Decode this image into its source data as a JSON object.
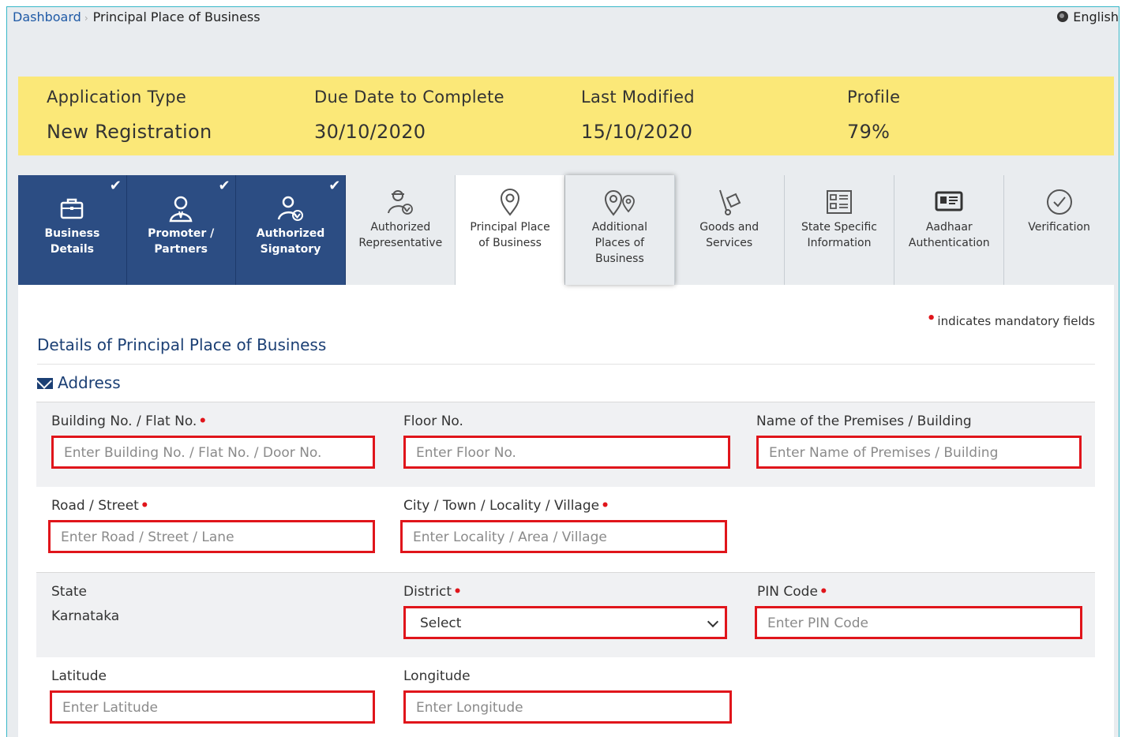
{
  "breadcrumb": {
    "home": "Dashboard",
    "current": "Principal Place of Business"
  },
  "language": "English",
  "info": [
    {
      "label": "Application Type",
      "value": "New Registration"
    },
    {
      "label": "Due Date to Complete",
      "value": "30/10/2020"
    },
    {
      "label": "Last Modified",
      "value": "15/10/2020"
    },
    {
      "label": "Profile",
      "value": "79%"
    }
  ],
  "tabs": [
    {
      "line1": "Business",
      "line2": "Details",
      "line3": "",
      "state": "done",
      "icon": "briefcase-icon"
    },
    {
      "line1": "Promoter /",
      "line2": "Partners",
      "line3": "",
      "state": "done",
      "icon": "person-icon"
    },
    {
      "line1": "Authorized",
      "line2": "Signatory",
      "line3": "",
      "state": "done",
      "icon": "signatory-icon"
    },
    {
      "line1": "Authorized",
      "line2": "Representative",
      "line3": "",
      "state": "pending",
      "icon": "representative-icon"
    },
    {
      "line1": "Principal Place",
      "line2": "of Business",
      "line3": "",
      "state": "active",
      "icon": "location-pin-icon"
    },
    {
      "line1": "Additional",
      "line2": "Places of",
      "line3": "Business",
      "state": "pending",
      "icon": "multi-location-icon"
    },
    {
      "line1": "Goods and",
      "line2": "Services",
      "line3": "",
      "state": "pending",
      "icon": "trolley-icon"
    },
    {
      "line1": "State Specific",
      "line2": "Information",
      "line3": "",
      "state": "pending",
      "icon": "form-icon"
    },
    {
      "line1": "Aadhaar",
      "line2": "Authentication",
      "line3": "",
      "state": "pending",
      "icon": "id-card-icon"
    },
    {
      "line1": "Verification",
      "line2": "",
      "line3": "",
      "state": "pending",
      "icon": "check-circle-icon"
    }
  ],
  "mandatory_note": "indicates mandatory fields",
  "section_title": "Details of Principal Place of Business",
  "address_title": "Address",
  "fields": {
    "building": {
      "label": "Building No. / Flat No.",
      "placeholder": "Enter Building No. / Flat No. / Door No."
    },
    "floor": {
      "label": "Floor No.",
      "placeholder": "Enter Floor No."
    },
    "premises": {
      "label": "Name of the Premises / Building",
      "placeholder": "Enter Name of Premises / Building"
    },
    "road": {
      "label": "Road / Street",
      "placeholder": "Enter Road / Street / Lane"
    },
    "city": {
      "label": "City / Town / Locality / Village",
      "placeholder": "Enter Locality / Area / Village"
    },
    "state": {
      "label": "State",
      "value": "Karnataka"
    },
    "district": {
      "label": "District",
      "selected": "Select"
    },
    "pin": {
      "label": "PIN Code",
      "placeholder": "Enter PIN Code"
    },
    "latitude": {
      "label": "Latitude",
      "placeholder": "Enter Latitude"
    },
    "longitude": {
      "label": "Longitude",
      "placeholder": "Enter Longitude"
    }
  },
  "colors": {
    "accent_navy": "#2c4d83",
    "info_yellow": "#fbe878",
    "required_red": "#e0151b",
    "link_blue": "#1f5aa6"
  }
}
